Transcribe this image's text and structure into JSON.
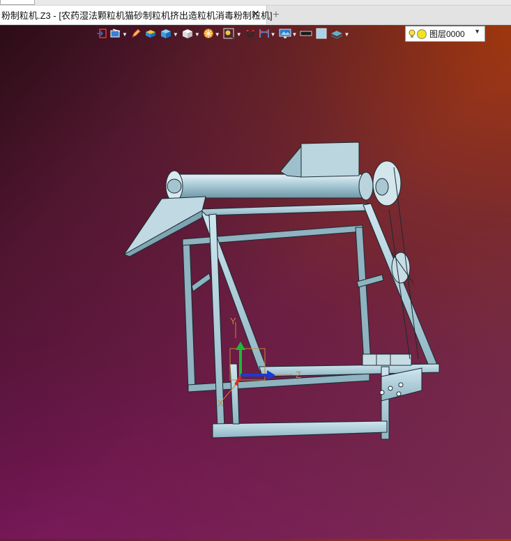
{
  "top_field": "",
  "tab": {
    "title": "粉制粒机.Z3 - [农药湿法颗粒机猫砂制粒机挤出造粒机消毒粉制粒机]",
    "close": "✕",
    "add": "+"
  },
  "toolbar": {
    "icons": [
      "exit-icon",
      "view-icon",
      "pencil-icon",
      "render-icon",
      "solid-icon",
      "cube-icon",
      "wheel-icon",
      "zoom-icon",
      "magnet-icon",
      "dimension-icon",
      "display-icon",
      "line-color-swatch",
      "fill-color-swatch",
      "layer-stack-icon"
    ],
    "line_color": "#1a1a1a",
    "fill_color": "#a9d2ec"
  },
  "layer": {
    "name": "图层0000",
    "color": "#f3e31a"
  },
  "axes": {
    "x": "X",
    "y": "Y",
    "z": "Z"
  }
}
